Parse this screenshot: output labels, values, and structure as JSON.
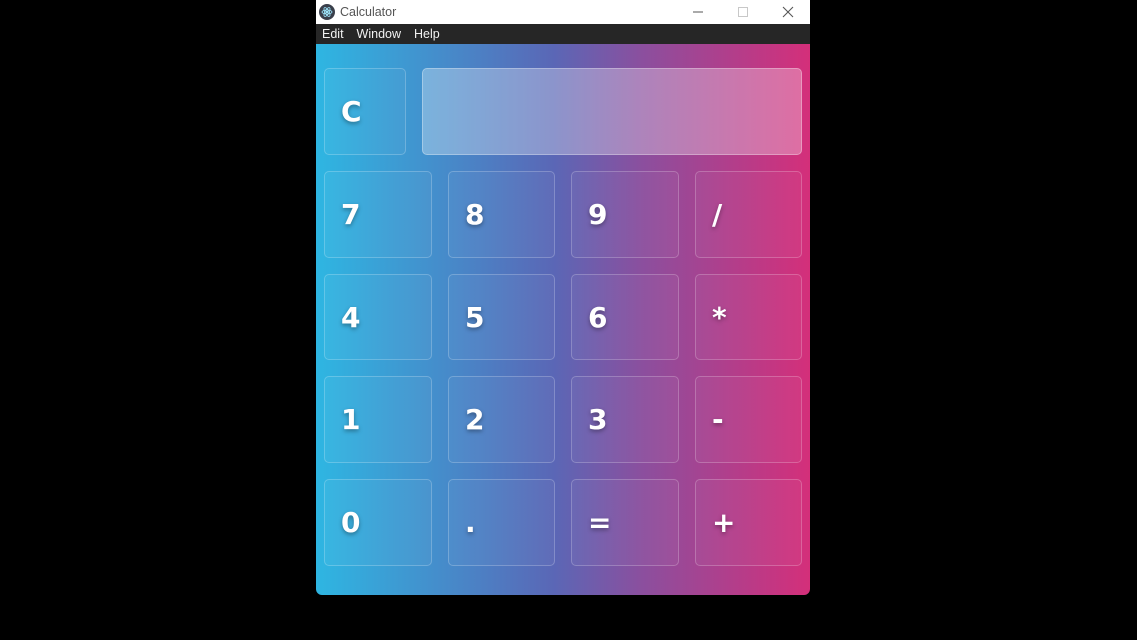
{
  "window": {
    "title": "Calculator",
    "controls": {
      "minimize_icon": "minimize-icon",
      "maximize_icon": "maximize-icon",
      "close_icon": "close-icon"
    }
  },
  "menu": {
    "items": [
      "Edit",
      "Window",
      "Help"
    ]
  },
  "calculator": {
    "display_value": "",
    "clear_label": "C",
    "rows": [
      [
        "7",
        "8",
        "9",
        "/"
      ],
      [
        "4",
        "5",
        "6",
        "*"
      ],
      [
        "1",
        "2",
        "3",
        "-"
      ],
      [
        "0",
        ".",
        "=",
        "+"
      ]
    ]
  },
  "colors": {
    "gradient_left": "#2eb6e2",
    "gradient_mid": "#5a67b6",
    "gradient_right": "#d42f7a",
    "menubar_bg": "#262626",
    "titlebar_bg": "#ffffff"
  }
}
